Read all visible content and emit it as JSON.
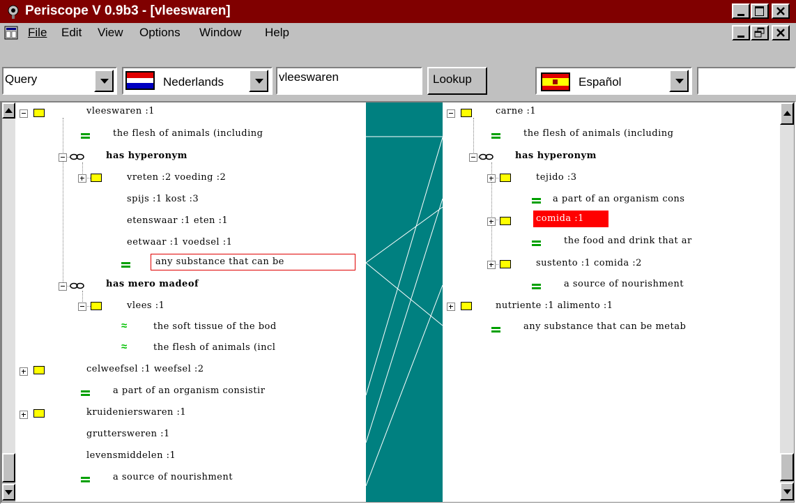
{
  "window": {
    "title": "Periscope V 0.9b3 - [vleeswaren]",
    "colors": {
      "titlebar": "#800000",
      "pane_middle": "#008080",
      "highlight_red": "#ff0000",
      "gloss_equal": "#00a000"
    }
  },
  "menu": {
    "items": [
      "File",
      "Edit",
      "View",
      "Options",
      "Window",
      "Help"
    ]
  },
  "toolbar": {
    "mode_select": "Query",
    "source_language": "Nederlands",
    "query_value": "vleeswaren",
    "lookup_label": "Lookup",
    "target_language": "Español",
    "target_value": ""
  },
  "left_tree": {
    "root": "vleeswaren :1",
    "root_gloss": "the flesh of animals (including",
    "hyperonym_label": "has hyperonym",
    "hyper_synset": "vreten :2  voeding :2",
    "hyper_syn_2": "spijs :1  kost :3",
    "hyper_syn_3": "etenswaar :1  eten :1",
    "hyper_syn_4": "eetwaar :1  voedsel :1",
    "hyper_gloss": "any substance that can be",
    "mero_label": "has mero madeof",
    "mero_synset": "vlees :1",
    "mero_gloss_1": "the soft tissue of the bod",
    "mero_gloss_2": "the flesh of animals (incl",
    "item_celweefsel": "celweefsel :1  weefsel :2",
    "gloss_celweefsel": "a part of an organism consistir",
    "item_kruideniers": "kruidenierswaren :1",
    "item_grutters": "gruttersweren :1",
    "item_levens": "levensmiddelen :1",
    "gloss_nourish": "a source of nourishment"
  },
  "right_tree": {
    "root": "carne :1",
    "root_gloss": "the flesh of animals (including",
    "hyperonym_label": "has hyperonym",
    "tejido": "tejido :3",
    "tejido_gloss": "a part of an organism cons",
    "comida": "comida :1",
    "comida_gloss": "the food and drink that ar",
    "sustento": "sustento :1  comida :2",
    "sustento_gloss": "a source of nourishment",
    "nutriente": "nutriente :1  alimento :1",
    "nutriente_gloss": "any substance that can be metab"
  }
}
